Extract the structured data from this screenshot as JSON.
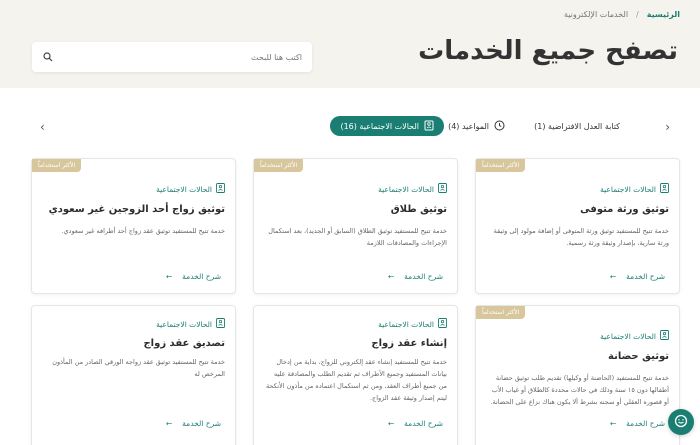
{
  "breadcrumb": {
    "home": "الرئيسية",
    "separator": "/",
    "current": "الخدمات الإلكترونية"
  },
  "page_title": "تصفح جميع الخدمات",
  "search": {
    "placeholder": "اكتب هنا للبحث"
  },
  "tabs": [
    {
      "label": "كتابة العدل الافتراضية (1)",
      "active": false
    },
    {
      "label": "المواعيد (4)",
      "active": false
    },
    {
      "label": "الحالات الاجتماعية (16)",
      "active": true
    }
  ],
  "cards": [
    {
      "badge": "الأكثر استخداماً",
      "category": "الحالات الاجتماعية",
      "title": "توثيق ورثة متوفى",
      "description": "خدمة تتيح للمستفيد توثيق ورثة المتوفى أو إضافة مولود إلى وثيقة ورثة سارية، بإصدار وثيقة ورثة رسمية.",
      "link": "شرح الخدمة"
    },
    {
      "badge": "الأكثر استخداماً",
      "category": "الحالات الاجتماعية",
      "title": "توثيق طلاق",
      "description": "خدمة تتيح للمستفيد توثيق الطلاق (السابق أو الجديد)، بعد استكمال الإجراءات والمصادقات اللازمة",
      "link": "شرح الخدمة"
    },
    {
      "badge": "الأكثر استخداماً",
      "category": "الحالات الاجتماعية",
      "title": "توثيق زواج أحد الزوجين غير سعودي",
      "description": "خدمة تتيح للمستفيد توثيق عقد زواج أحد أطرافه غير سعودي.",
      "link": "شرح الخدمة"
    },
    {
      "badge": "الأكثر استخداماً",
      "category": "الحالات الاجتماعية",
      "title": "توثيق حضانة",
      "description": "خدمة تتيح للمستفيد (الحاضنة أو وكيلها) تقديم طلب توثيق حضانة أطفالها دون ١٥ سنة وذلك في حالات محددة كالطلاق أو غياب الأب أو قصوره العقلي أو سجنه بشرط ألا يكون هناك نزاع على الحضانة.",
      "link": "شرح الخدمة"
    },
    {
      "badge": "",
      "category": "الحالات الاجتماعية",
      "title": "إنشاء عقد زواج",
      "description": "خدمة تتيح للمستفيد إنشاء عقد إلكتروني للزواج، بداية من إدخال بيانات المستفيد وجميع الأطراف ثم تقديم الطلب والمصادقة عليه من جميع أطراف العقد، ومن ثم استكمال اعتماده من مأذون الأنكحة ليتم إصدار وثيقة عقد الزواج.",
      "link": "شرح الخدمة"
    },
    {
      "badge": "",
      "category": "الحالات الاجتماعية",
      "title": "تصديق عقد زواج",
      "description": "خدمة تتيح للمستفيد توثيق عقد زواجه الورقي الصادر من المأذون المرخص له",
      "link": "شرح الخدمة"
    }
  ],
  "colors": {
    "accent": "#1b7e72",
    "badge": "#d8c79d",
    "header_bg": "#f4f3ee"
  },
  "icons": {
    "search": "search-icon",
    "tab1": "none",
    "tab2": "clock-icon",
    "tab3": "family-icon",
    "card_category": "family-icon",
    "link": "arrow-left-icon",
    "fab": "chat-icon"
  }
}
